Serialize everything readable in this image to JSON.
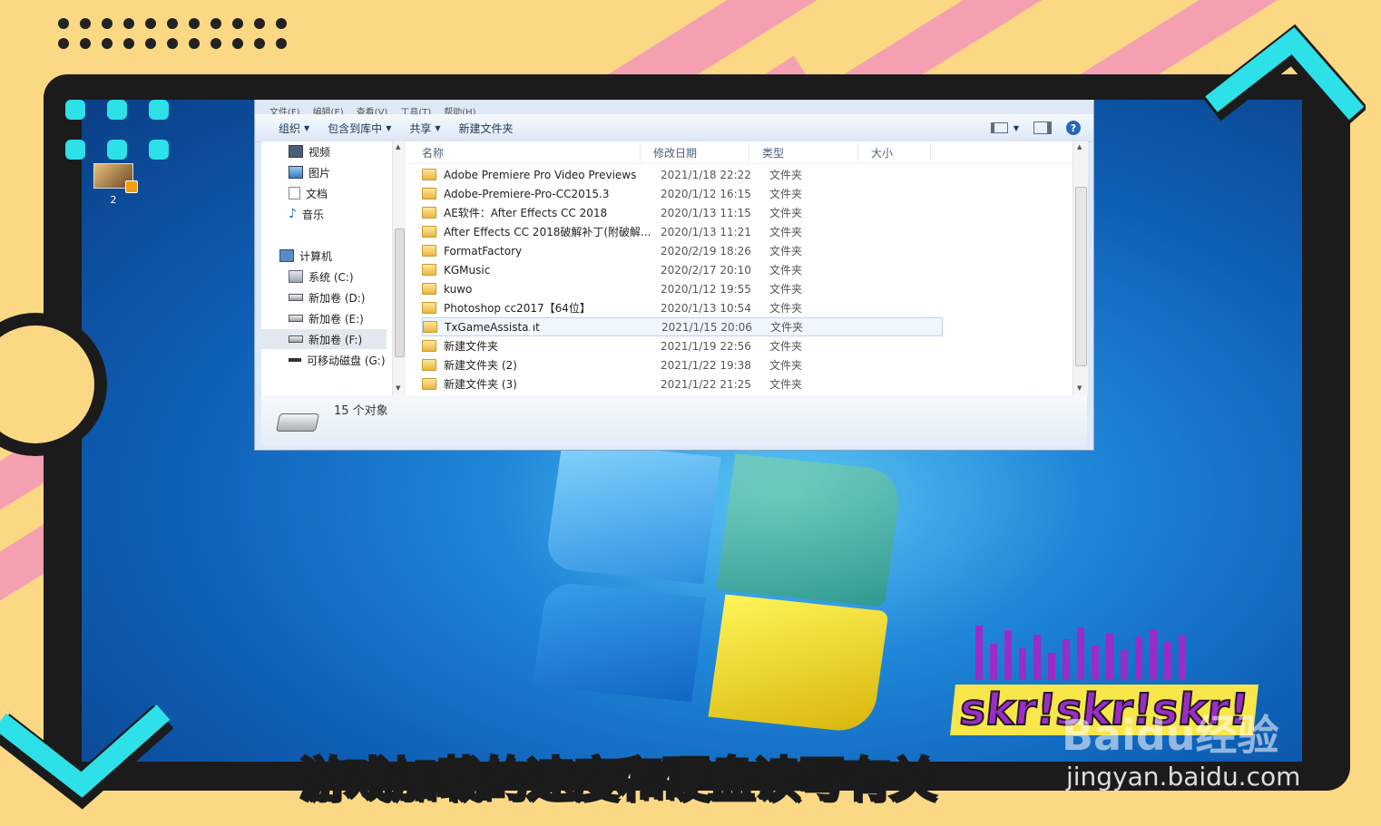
{
  "menu": [
    "文件(F)",
    "编辑(E)",
    "查看(V)",
    "工具(T)",
    "帮助(H)"
  ],
  "toolbar": {
    "organize": "组织",
    "include_library": "包含到库中",
    "share": "共享",
    "new_folder": "新建文件夹"
  },
  "nav": [
    {
      "label": "视频",
      "icon": "video-icon"
    },
    {
      "label": "图片",
      "icon": "picture-icon"
    },
    {
      "label": "文档",
      "icon": "document-icon"
    },
    {
      "label": "音乐",
      "icon": "music-icon"
    },
    {
      "label": "计算机",
      "icon": "computer-icon"
    },
    {
      "label": "系统 (C:)",
      "icon": "system-drive-icon"
    },
    {
      "label": "新加卷 (D:)",
      "icon": "drive-icon"
    },
    {
      "label": "新加卷 (E:)",
      "icon": "drive-icon"
    },
    {
      "label": "新加卷 (F:)",
      "icon": "drive-icon",
      "selected": true
    },
    {
      "label": "可移动磁盘 (G:)",
      "icon": "usb-drive-icon"
    }
  ],
  "columns": {
    "name": "名称",
    "date": "修改日期",
    "type": "类型",
    "size": "大小"
  },
  "files": [
    {
      "name": "Adobe Premiere Pro Video Previews",
      "date": "2021/1/18 22:22",
      "type": "文件夹"
    },
    {
      "name": "Adobe-Premiere-Pro-CC2015.3",
      "date": "2020/1/12 16:15",
      "type": "文件夹"
    },
    {
      "name": "AE软件：After Effects CC 2018",
      "date": "2020/1/13 11:15",
      "type": "文件夹"
    },
    {
      "name": "After Effects CC 2018破解补丁(附破解...",
      "date": "2020/1/13 11:21",
      "type": "文件夹"
    },
    {
      "name": "FormatFactory",
      "date": "2020/2/19 18:26",
      "type": "文件夹"
    },
    {
      "name": "KGMusic",
      "date": "2020/2/17 20:10",
      "type": "文件夹"
    },
    {
      "name": "kuwo",
      "date": "2020/1/12 19:55",
      "type": "文件夹"
    },
    {
      "name": "Photoshop cc2017【64位】",
      "date": "2020/1/13 10:54",
      "type": "文件夹"
    },
    {
      "name": "TxGameAssistant",
      "date": "2021/1/15 20:06",
      "type": "文件夹",
      "hover": true
    },
    {
      "name": "新建文件夹",
      "date": "2021/1/19 22:56",
      "type": "文件夹"
    },
    {
      "name": "新建文件夹 (2)",
      "date": "2021/1/22 19:38",
      "type": "文件夹"
    },
    {
      "name": "新建文件夹 (3)",
      "date": "2021/1/22 21:25",
      "type": "文件夹"
    }
  ],
  "status": {
    "count": "15 个对象"
  },
  "desktop": {
    "icon_label": "2"
  },
  "caption": "游戏加载的速度和硬盘读写有关",
  "skr_text": "skr!skr!skr!",
  "watermark": {
    "brand": "Baidu经验",
    "url": "jingyan.baidu.com"
  },
  "colors": {
    "accent_cyan": "#2ee0e7",
    "stripe_pink": "#f4a0b1",
    "bg_yellow": "#fbd984",
    "purple": "#9b2cc6"
  }
}
